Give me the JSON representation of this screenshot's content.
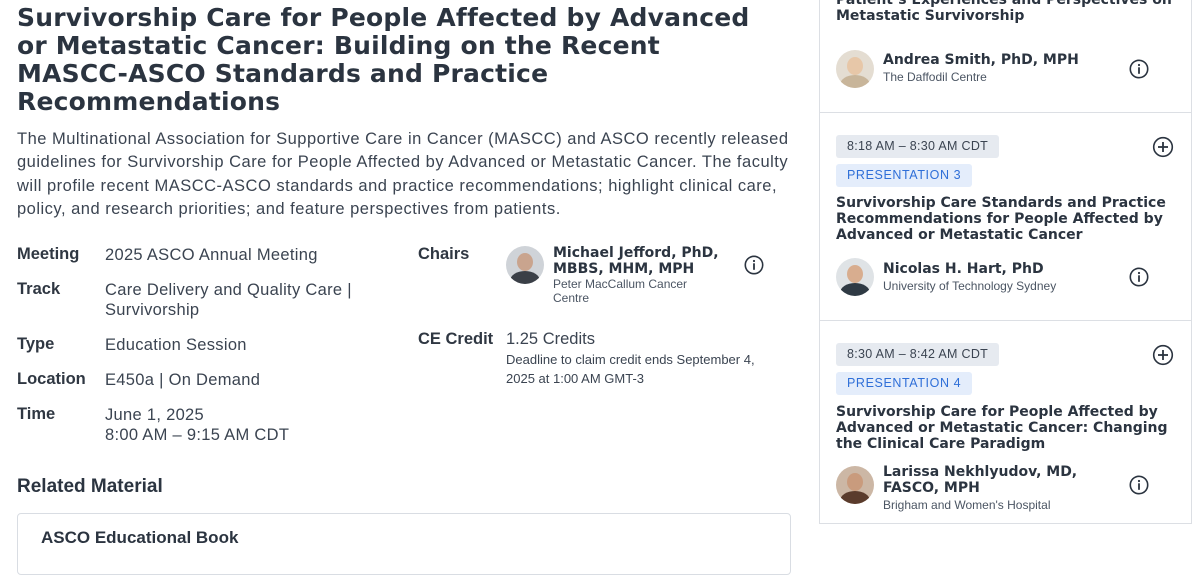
{
  "session": {
    "title": "Survivorship Care for People Affected by Advanced or Metastatic Cancer: Building on the Recent MASCC-ASCO Standards and Practice Recommendations",
    "description": "The Multinational Association for Supportive Care in Cancer (MASCC) and ASCO recently released guidelines for Survivorship Care for People Affected by Advanced or Metastatic Cancer. The faculty will profile recent MASCC-ASCO standards and practice recommendations; highlight clinical care, policy, and research priorities; and feature perspectives from patients."
  },
  "details": {
    "meeting_label": "Meeting",
    "meeting_value": "2025 ASCO Annual Meeting",
    "track_label": "Track",
    "track_value": "Care Delivery and Quality Care | Survivorship",
    "type_label": "Type",
    "type_value": "Education Session",
    "location_label": "Location",
    "location_value": "E450a | On Demand",
    "time_label": "Time",
    "time_date": "June 1, 2025",
    "time_range": "8:00 AM – 9:15 AM CDT"
  },
  "chairs": {
    "label": "Chairs",
    "name": "Michael Jefford, PhD, MBBS, MHM, MPH",
    "affiliation": "Peter MacCallum Cancer Centre"
  },
  "ce": {
    "label": "CE Credit",
    "value": "1.25 Credits",
    "deadline": "Deadline to claim credit ends September 4, 2025 at 1:00 AM GMT-3"
  },
  "related": {
    "title": "Related Material",
    "card_title": "ASCO Educational Book"
  },
  "sidebar": {
    "partial_title": "Patient’s Experiences and Perspectives on Metastatic Survivorship",
    "partial_speaker": {
      "name": "Andrea Smith, PhD, MPH",
      "affiliation": "The Daffodil Centre"
    },
    "presentations": [
      {
        "time": "8:18 AM – 8:30 AM CDT",
        "label": "PRESENTATION 3",
        "title": "Survivorship Care Standards and Practice Recommendations for People Affected by Advanced or Metastatic Cancer",
        "speaker": "Nicolas H. Hart, PhD",
        "affiliation": "University of Technology Sydney"
      },
      {
        "time": "8:30 AM – 8:42 AM CDT",
        "label": "PRESENTATION 4",
        "title": "Survivorship Care for People Affected by Advanced or Metastatic Cancer: Changing the Clinical Care Paradigm",
        "speaker": "Larissa Nekhlyudov, MD, FASCO, MPH",
        "affiliation": "Brigham and Women's Hospital"
      }
    ]
  },
  "icons": {
    "info": "info-circle-icon",
    "add": "plus-circle-icon",
    "accent": "#2f6fd8"
  }
}
